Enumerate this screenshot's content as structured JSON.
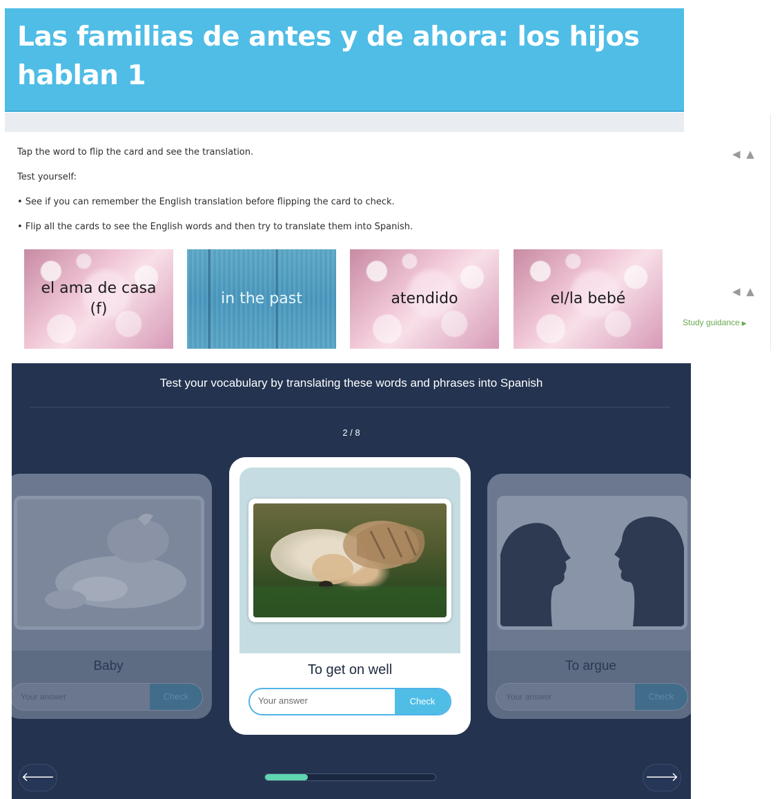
{
  "header": {
    "title": "Las familias de antes y de ahora: los hijos hablan 1"
  },
  "instructions": [
    "Tap the word to flip the card and see the translation.",
    "Test yourself:",
    "• See if you can remember the English translation before flipping the card to check.",
    "• Flip all the cards to see the English words and then try to translate them into Spanish."
  ],
  "flashcards": [
    {
      "text": "el ama de casa (f)",
      "style": "pink"
    },
    {
      "text": "in the past",
      "style": "wood"
    },
    {
      "text": "atendido",
      "style": "pink"
    },
    {
      "text": "el/la bebé",
      "style": "pink"
    }
  ],
  "side_controls": {
    "arrows": "◀ ▲",
    "study_link": "Study guidance"
  },
  "quiz": {
    "title": "Test your vocabulary by translating these words and phrases into Spanish",
    "counter": "2 / 8",
    "progress": 0.25,
    "cards": {
      "prev": {
        "label": "Baby",
        "placeholder": "Your answer",
        "check": "Check",
        "image": "baby"
      },
      "current": {
        "label": "To get on well",
        "placeholder": "Your answer",
        "check": "Check",
        "image": "cat and dog"
      },
      "next": {
        "label": "To argue",
        "placeholder": "Your answer",
        "check": "Check",
        "image": "arguing silhouettes"
      }
    }
  },
  "colors": {
    "header": "#4fbde6",
    "quiz_bg": "#233350",
    "accent": "#4fbde6",
    "progress": "#5fd6b0",
    "link": "#6aa84f"
  },
  "icons": {
    "prev": "arrow-left-icon",
    "next": "arrow-right-icon",
    "study": "play-triangle-icon"
  }
}
